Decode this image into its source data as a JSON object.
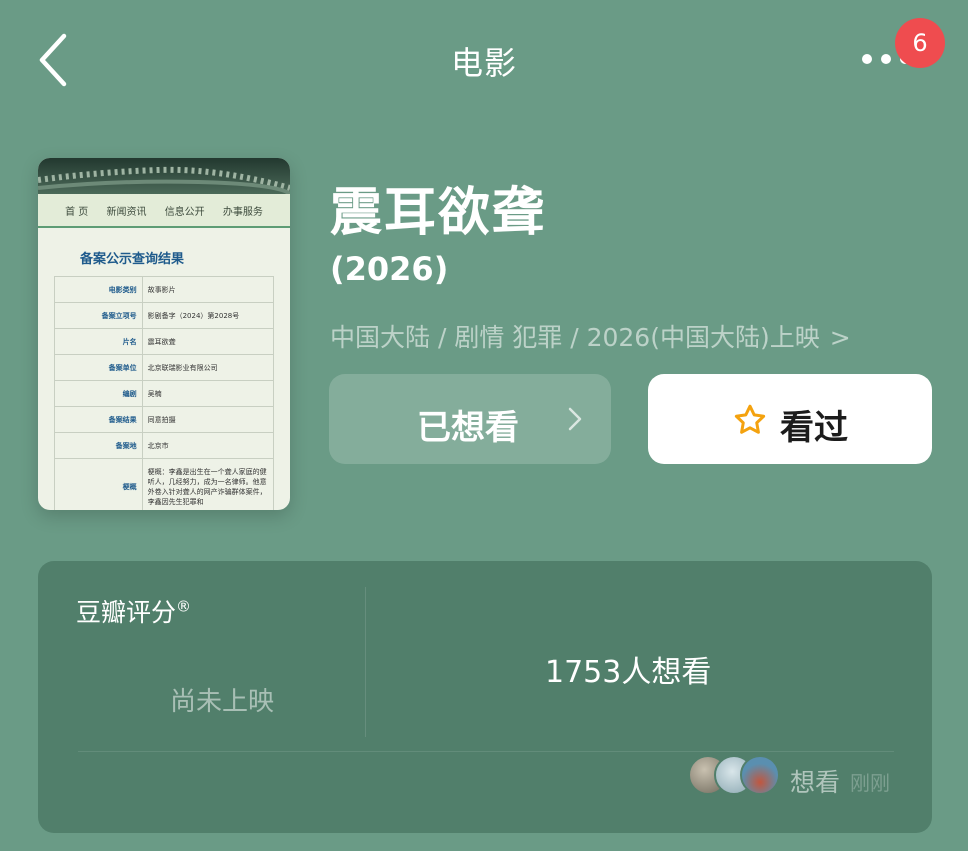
{
  "header": {
    "title": "电影",
    "back_icon": "chevron-left-icon",
    "more_icon": "more-dots-icon",
    "badge_count": "6"
  },
  "poster": {
    "nav": [
      "首 页",
      "新闻资讯",
      "信息公开",
      "办事服务"
    ],
    "heading": "备案公示查询结果",
    "rows": [
      {
        "k": "电影类别",
        "v": "故事影片"
      },
      {
        "k": "备案立项号",
        "v": "影剧备字（2024）第2028号"
      },
      {
        "k": "片名",
        "v": "震耳欲聋"
      },
      {
        "k": "备案单位",
        "v": "北京联瑞影业有限公司"
      },
      {
        "k": "编剧",
        "v": "吴楠"
      },
      {
        "k": "备案结果",
        "v": "同意拍摄"
      },
      {
        "k": "备案地",
        "v": "北京市"
      },
      {
        "k": "梗概",
        "v": "梗概：李鑫是出生在一个聋人家庭的健听人，几经努力，成为一名律师。他意外卷入针对聋人的网产诈骗群体案件，李鑫因先生犯罪和"
      }
    ]
  },
  "movie": {
    "title": "震耳欲聋",
    "year": "(2026)",
    "meta": "中国大陆 / 剧情 犯罪 / 2026(中国大陆)上映",
    "meta_chevron": ">"
  },
  "buttons": {
    "wish_label": "已想看",
    "wish_chevron": ">",
    "seen_label": "看过",
    "seen_icon": "star-outline-icon",
    "accent": "#f4a20f"
  },
  "rating": {
    "label": "豆瓣评分",
    "reg": "®",
    "status": "尚未上映",
    "wish_count": "1753人想看",
    "recent_action": "想看",
    "recent_time": "刚刚"
  }
}
